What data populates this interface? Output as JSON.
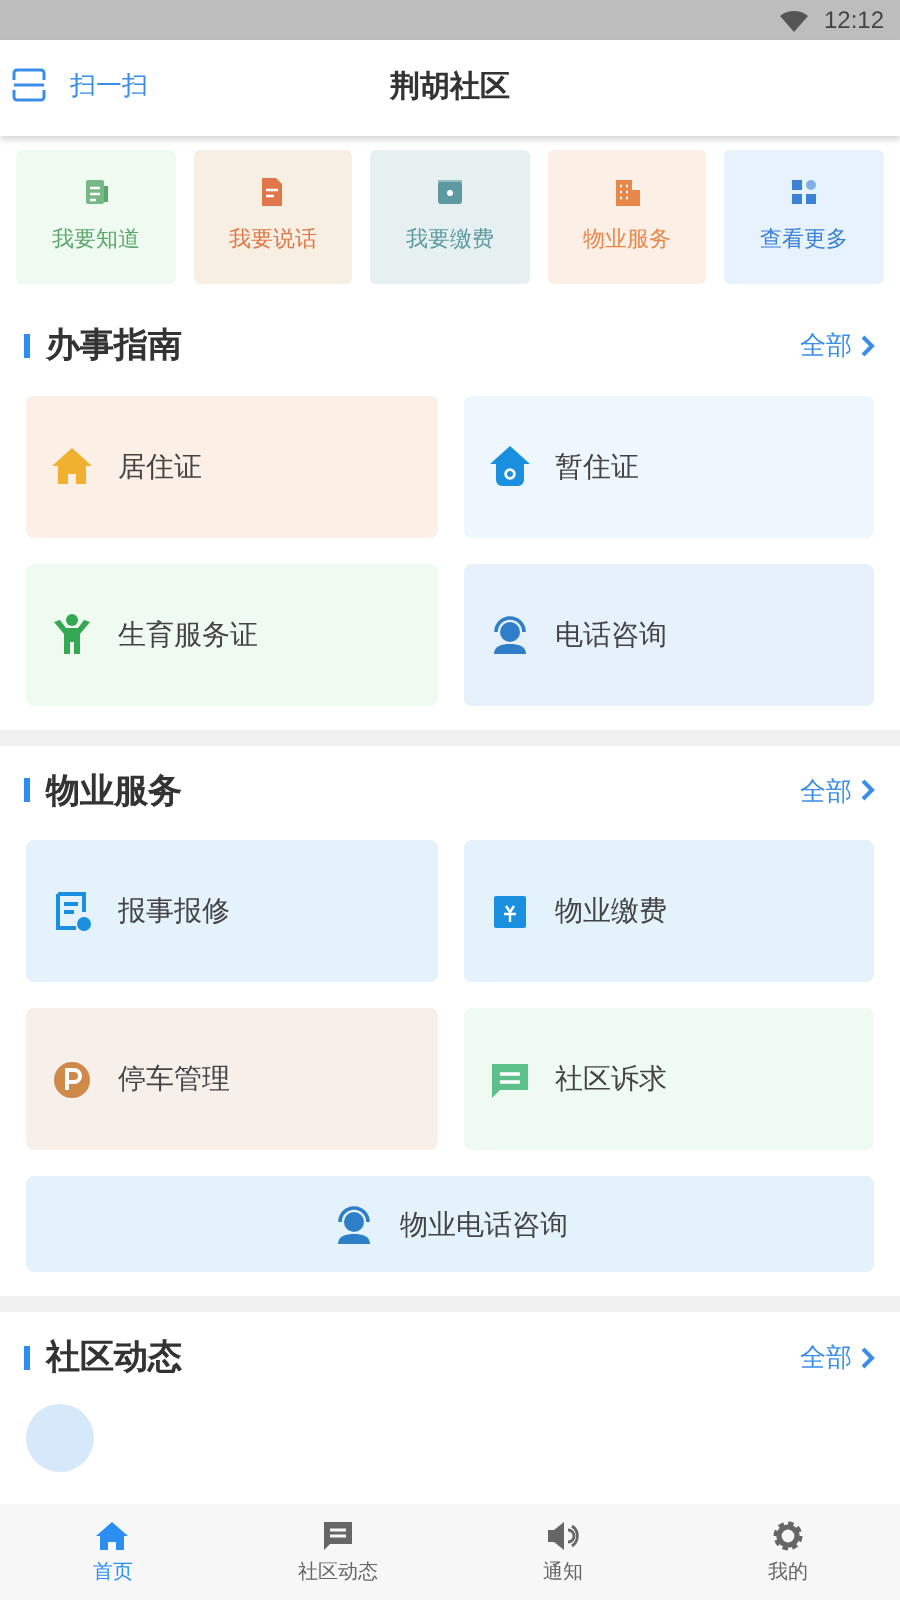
{
  "status_bar": {
    "time": "12:12"
  },
  "header": {
    "scan_label": "扫一扫",
    "title": "荆胡社区"
  },
  "quick_tiles": [
    {
      "kind": "know",
      "label": "我要知道",
      "color": "#5aa76a"
    },
    {
      "kind": "speak",
      "label": "我要说话",
      "color": "#e0774a"
    },
    {
      "kind": "pay",
      "label": "我要缴费",
      "color": "#5c9aa0"
    },
    {
      "kind": "property",
      "label": "物业服务",
      "color": "#e8874a"
    },
    {
      "kind": "more",
      "label": "查看更多",
      "color": "#3b82d6"
    }
  ],
  "sections": [
    {
      "title": "办事指南",
      "more": "全部",
      "cards": [
        {
          "kind": "residence",
          "label": "居住证"
        },
        {
          "kind": "temp",
          "label": "暂住证"
        },
        {
          "kind": "birth",
          "label": "生育服务证"
        },
        {
          "kind": "phone",
          "label": "电话咨询"
        }
      ]
    },
    {
      "title": "物业服务",
      "more": "全部",
      "cards": [
        {
          "kind": "repair",
          "label": "报事报修"
        },
        {
          "kind": "fee",
          "label": "物业缴费"
        },
        {
          "kind": "parking",
          "label": "停车管理"
        },
        {
          "kind": "appeal",
          "label": "社区诉求"
        },
        {
          "kind": "phone_wide",
          "label": "物业电话咨询"
        }
      ]
    },
    {
      "title": "社区动态",
      "more": "全部"
    }
  ],
  "bottom_nav": [
    {
      "kind": "home",
      "label": "首页",
      "selected": true
    },
    {
      "kind": "news",
      "label": "社区动态",
      "selected": false
    },
    {
      "kind": "notice",
      "label": "通知",
      "selected": false
    },
    {
      "kind": "me",
      "label": "我的",
      "selected": false
    }
  ]
}
